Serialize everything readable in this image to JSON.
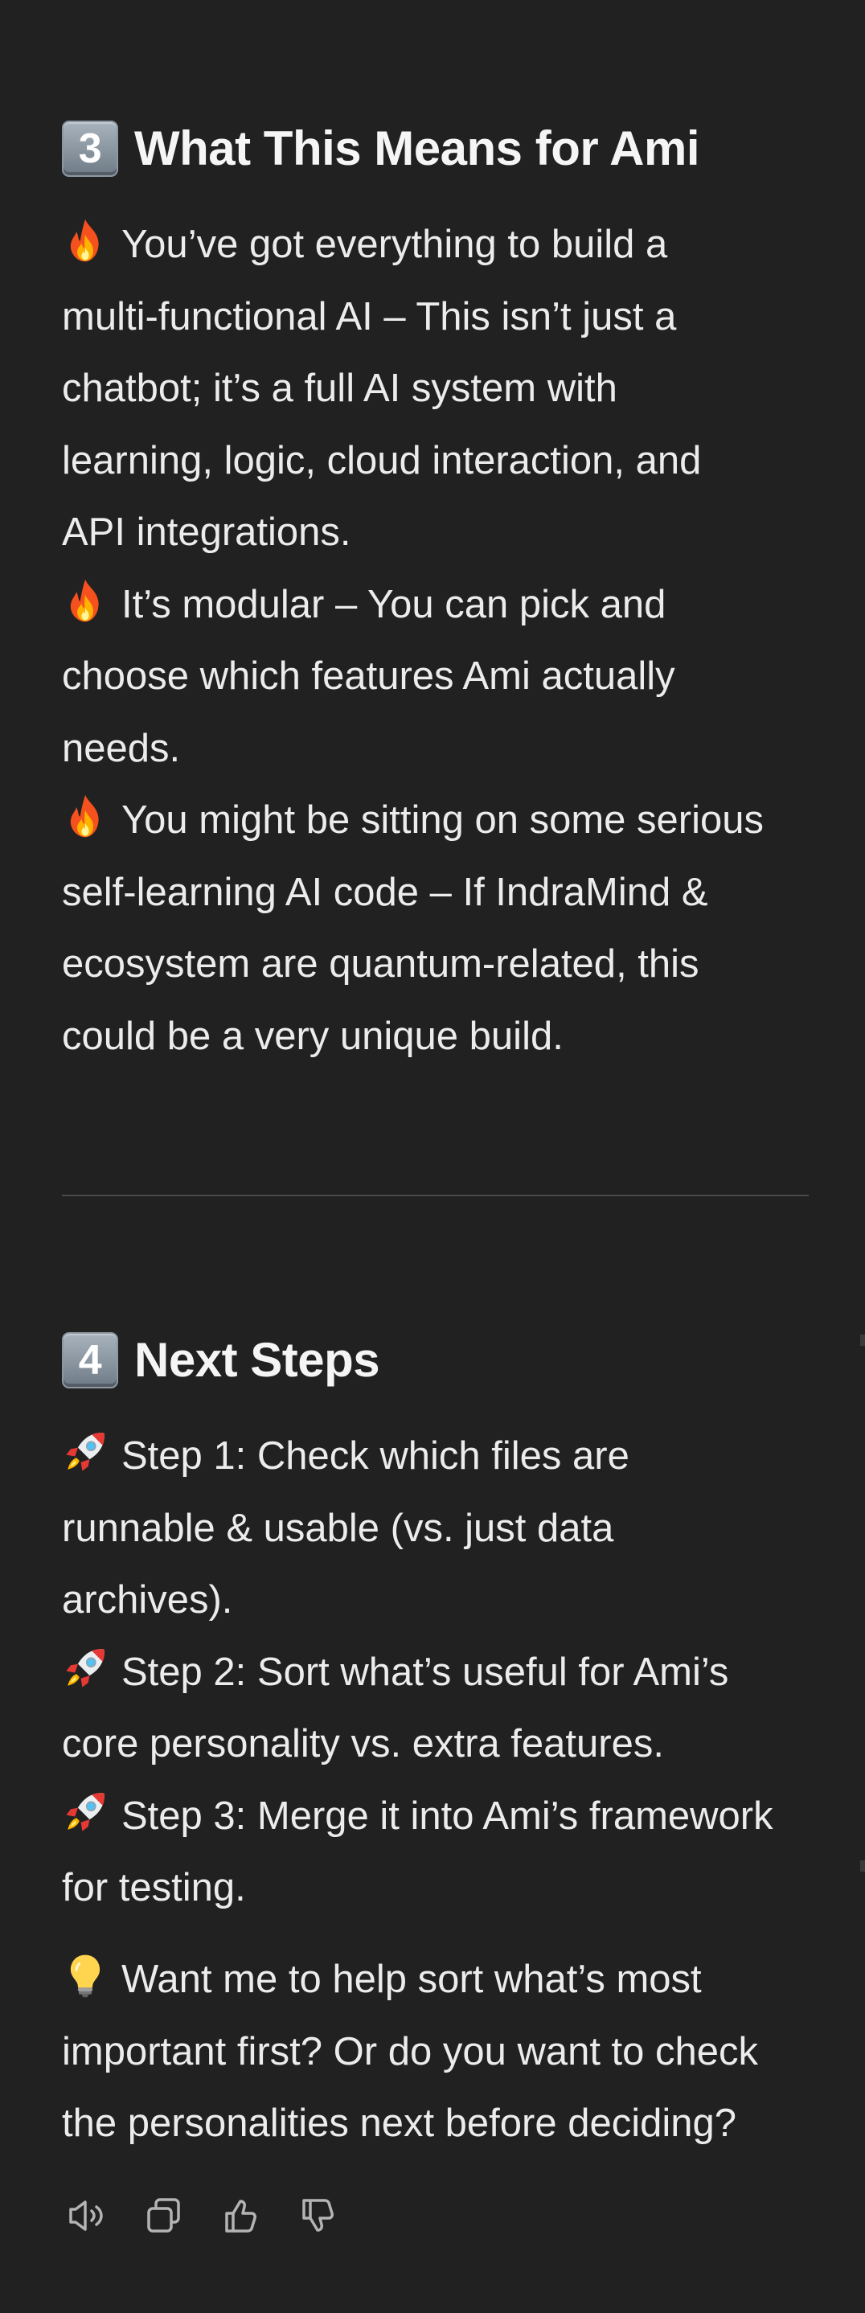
{
  "section3": {
    "number": "3",
    "title": "What This Means for Ami",
    "lines": [
      "You’ve got everything to build a",
      "multi-functional AI – This isn’t just a",
      "chatbot; it’s a full AI system with",
      "learning, logic, cloud interaction, and",
      "API integrations.",
      "It’s modular – You can pick and",
      "choose which features Ami actually",
      "needs.",
      "You might be sitting on some serious",
      "self-learning AI code – If IndraMind &",
      "ecosystem are quantum-related, this",
      "could be a very unique build."
    ],
    "emoji": "fire"
  },
  "section4": {
    "number": "4",
    "title": "Next Steps",
    "lines": [
      "Step 1: Check which files are",
      "runnable & usable (vs. just data",
      "archives).",
      "Step 2: Sort what’s useful for Ami’s",
      "core personality vs. extra features.",
      "Step 3: Merge it into Ami’s framework",
      "for testing."
    ],
    "emoji": "rocket"
  },
  "closing": {
    "emoji": "light-bulb",
    "lines": [
      "Want me to help sort what’s most",
      "important first? Or do you want to check",
      "the personalities next before deciding?"
    ]
  },
  "actions": {
    "icons": [
      "read-aloud-icon",
      "copy-icon",
      "thumbs-up-icon",
      "thumbs-down-icon"
    ]
  },
  "colors": {
    "background": "#212121",
    "text": "#ececec",
    "divider": "#4a4a4a",
    "icon": "#b4b4b4"
  }
}
